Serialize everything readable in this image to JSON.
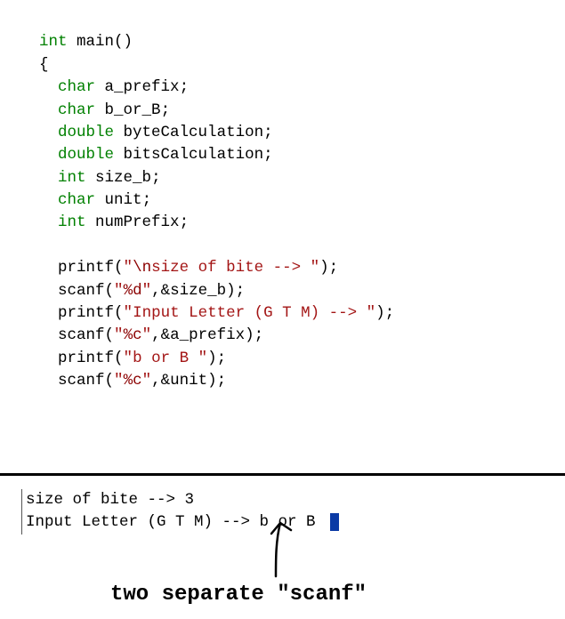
{
  "code": {
    "line1": {
      "type": "int",
      "space": " ",
      "name": "main",
      "paren": "()"
    },
    "line2": "{",
    "decl1": {
      "type": "char",
      "name": "a_prefix"
    },
    "decl2": {
      "type": "char",
      "name": "b_or_B"
    },
    "decl3": {
      "type": "double",
      "name": "byteCalculation"
    },
    "decl4": {
      "type": "double",
      "name": "bitsCalculation"
    },
    "decl5": {
      "type": "int",
      "name": "size_b"
    },
    "decl6": {
      "type": "char",
      "name": "unit"
    },
    "decl7": {
      "type": "int",
      "name": "numPrefix"
    },
    "stmt1": {
      "func": "printf",
      "q1": "\"",
      "esc": "\\n",
      "s1": "size of bite --> ",
      "q2": "\"",
      "tail": ");"
    },
    "stmt2": {
      "func": "scanf",
      "q1": "\"",
      "fmt": "%d",
      "q2": "\"",
      "arg": ",&size_b);"
    },
    "stmt3": {
      "func": "printf",
      "q1": "\"",
      "s1": "Input Letter (G T M) --> ",
      "q2": "\"",
      "tail": ");"
    },
    "stmt4": {
      "func": "scanf",
      "q1": "\"",
      "fmt": "%c",
      "q2": "\"",
      "arg": ",&a_prefix);"
    },
    "stmt5": {
      "func": "printf",
      "q1": "\"",
      "s1": "b or B ",
      "q2": "\"",
      "tail": ");"
    },
    "stmt6": {
      "func": "scanf",
      "q1": "\"",
      "fmt": "%c",
      "q2": "\"",
      "arg": ",&unit);"
    }
  },
  "console": {
    "line1": "size of bite --> 3",
    "line2": "Input Letter (G T M) --> b or B "
  },
  "annotation": "two separate \"scanf\""
}
